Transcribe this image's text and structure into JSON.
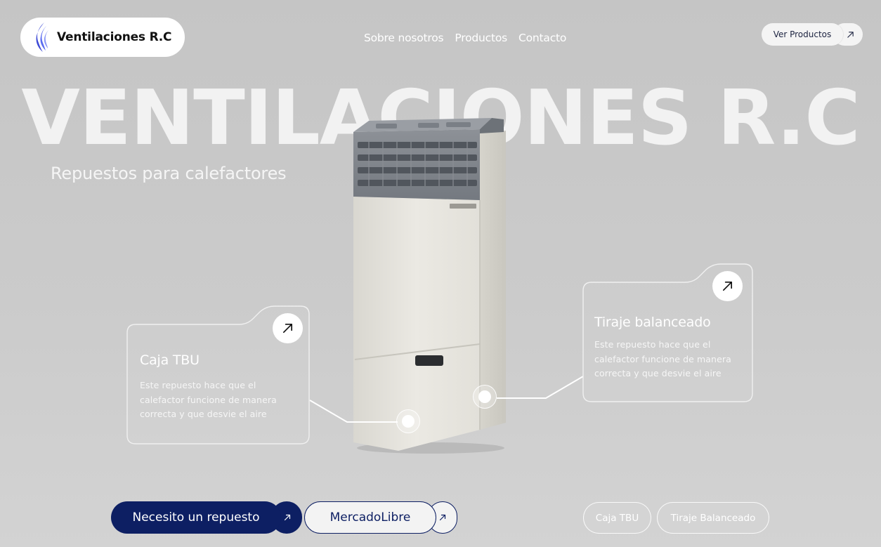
{
  "header": {
    "logo_text": "Ventilaciones R.C",
    "logo_flame_color": "#4f5ee8",
    "nav": [
      "Sobre nosotros",
      "Productos",
      "Contacto"
    ],
    "cta_label": "Ver Productos"
  },
  "hero": {
    "title": "VENTILACIONES R.C",
    "subtitle": "Repuestos para calefactores"
  },
  "cards": [
    {
      "title": "Caja TBU",
      "description": "Este repuesto hace que el calefactor funcione de manera correcta y que desvie el aire"
    },
    {
      "title": "Tiraje balanceado",
      "description": "Este repuesto hace que el calefactor funcione de manera correcta y que desvie el aire"
    }
  ],
  "actions": {
    "primary_label": "Necesito un repuesto",
    "secondary_label": "MercadoLibre"
  },
  "tags": [
    "Caja TBU",
    "Tiraje Balanceado"
  ],
  "colors": {
    "background": "#c9c9c9",
    "primary": "#0d1f63",
    "accent_flame": "#4f5ee8",
    "card_border": "#f0f0f0"
  }
}
